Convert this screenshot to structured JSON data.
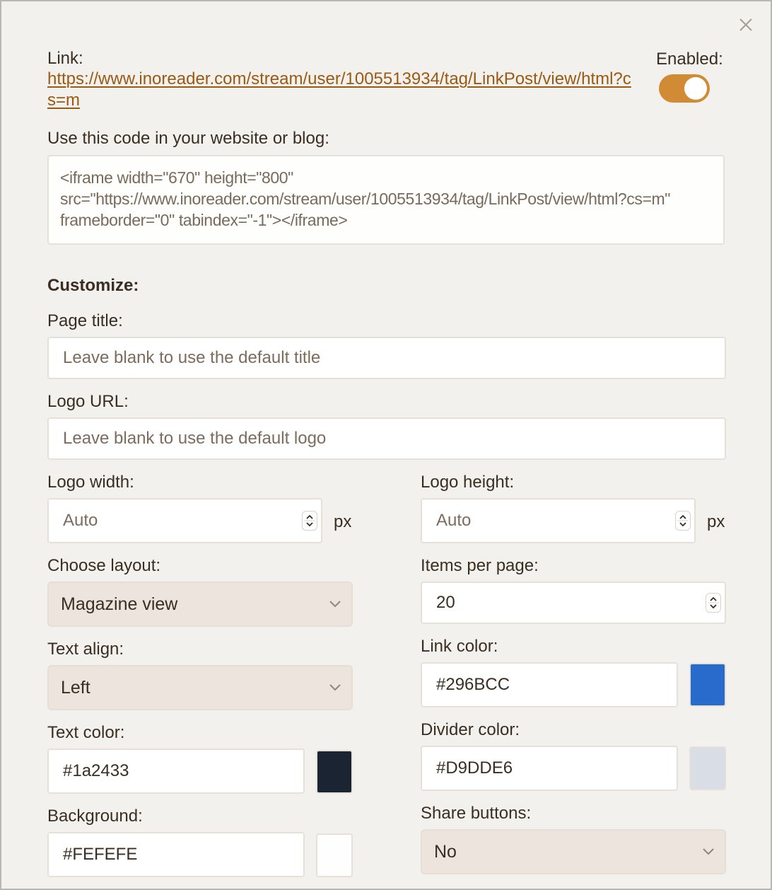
{
  "dialog": {
    "close_icon": "close-icon",
    "link_label": "Link:",
    "link_url": "https://www.inoreader.com/stream/user/1005513934/tag/LinkPost/view/html?cs=m",
    "enabled_label": "Enabled:",
    "enabled": true,
    "embed_label": "Use this code in your website or blog:",
    "embed_code": "<iframe width=\"670\" height=\"800\" src=\"https://www.inoreader.com/stream/user/1005513934/tag/LinkPost/view/html?cs=m\" frameborder=\"0\" tabindex=\"-1\"></iframe>",
    "accent_color": "#D18B35",
    "link_text_color": "#9A5A12"
  },
  "customize": {
    "heading": "Customize:",
    "page_title": {
      "label": "Page title:",
      "value": "",
      "placeholder": "Leave blank to use the default title"
    },
    "logo_url": {
      "label": "Logo URL:",
      "value": "",
      "placeholder": "Leave blank to use the default logo"
    },
    "logo_width": {
      "label": "Logo width:",
      "value": "",
      "placeholder": "Auto",
      "unit": "px"
    },
    "logo_height": {
      "label": "Logo height:",
      "value": "",
      "placeholder": "Auto",
      "unit": "px"
    },
    "layout": {
      "label": "Choose layout:",
      "selected": "Magazine view"
    },
    "items_per_page": {
      "label": "Items per page:",
      "value": "20"
    },
    "text_align": {
      "label": "Text align:",
      "selected": "Left"
    },
    "link_color": {
      "label": "Link color:",
      "value": "#296BCC",
      "swatch": "#296BCC"
    },
    "text_color": {
      "label": "Text color:",
      "value": "#1a2433",
      "swatch": "#1a2433"
    },
    "divider_color": {
      "label": "Divider color:",
      "value": "#D9DDE6",
      "swatch": "#D9DDE6"
    },
    "background": {
      "label": "Background:",
      "value": "#FEFEFE",
      "swatch": "#FEFEFE"
    },
    "share_buttons": {
      "label": "Share buttons:",
      "selected": "No"
    }
  }
}
